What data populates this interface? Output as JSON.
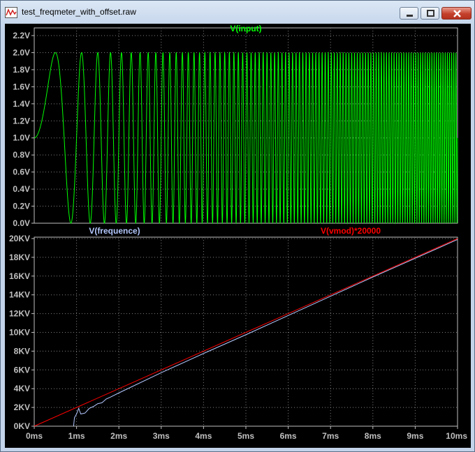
{
  "window": {
    "title": "test_freqmeter_with_offset.raw"
  },
  "colors": {
    "background": "#000000",
    "axis": "#c0c0c0",
    "grid": "#808080",
    "input": "#00ff00",
    "frequence": "#b4c8ff",
    "vmod": "#ff0000"
  },
  "chart_data": [
    {
      "type": "line",
      "title": "",
      "xlabel": "",
      "ylabel": "",
      "xlim": [
        0,
        10
      ],
      "ylim": [
        0,
        2.2
      ],
      "yticks": [
        "0.0V",
        "0.2V",
        "0.4V",
        "0.6V",
        "0.8V",
        "1.0V",
        "1.2V",
        "1.4V",
        "1.6V",
        "1.8V",
        "2.0V",
        "2.2V"
      ],
      "x_unit": "ms",
      "grid": true,
      "series": [
        {
          "name": "V(input)",
          "color": "#00ff00",
          "kind": "chirp",
          "offset": 1.0,
          "amplitude": 1.0,
          "freq_start_khz": 0,
          "freq_end_khz": 20
        }
      ]
    },
    {
      "type": "line",
      "title": "",
      "xlabel": "",
      "ylabel": "",
      "xlim": [
        0,
        10
      ],
      "ylim": [
        0,
        20
      ],
      "yticks": [
        "0KV",
        "2KV",
        "4KV",
        "6KV",
        "8KV",
        "10KV",
        "12KV",
        "14KV",
        "16KV",
        "18KV",
        "20KV"
      ],
      "xticks": [
        "0ms",
        "1ms",
        "2ms",
        "3ms",
        "4ms",
        "5ms",
        "6ms",
        "7ms",
        "8ms",
        "9ms",
        "10ms"
      ],
      "grid": true,
      "series": [
        {
          "name": "V(frequence)",
          "color": "#b4c8ff",
          "points": [
            [
              0.93,
              0
            ],
            [
              0.95,
              0.9
            ],
            [
              1.0,
              1.3
            ],
            [
              1.05,
              1.9
            ],
            [
              1.1,
              1.3
            ],
            [
              1.2,
              1.4
            ],
            [
              1.3,
              1.9
            ],
            [
              1.4,
              2.1
            ],
            [
              1.5,
              2.4
            ],
            [
              1.6,
              2.5
            ],
            [
              1.7,
              2.9
            ],
            [
              1.8,
              3.1
            ],
            [
              2.0,
              3.55
            ],
            [
              3.0,
              5.7
            ],
            [
              4.0,
              7.75
            ],
            [
              5.0,
              9.75
            ],
            [
              6.0,
              11.8
            ],
            [
              7.0,
              13.85
            ],
            [
              8.0,
              15.9
            ],
            [
              9.0,
              17.9
            ],
            [
              10.0,
              19.9
            ]
          ]
        },
        {
          "name": "V(vmod)*20000",
          "color": "#ff0000",
          "points": [
            [
              0,
              0
            ],
            [
              10,
              20
            ]
          ]
        }
      ]
    }
  ]
}
